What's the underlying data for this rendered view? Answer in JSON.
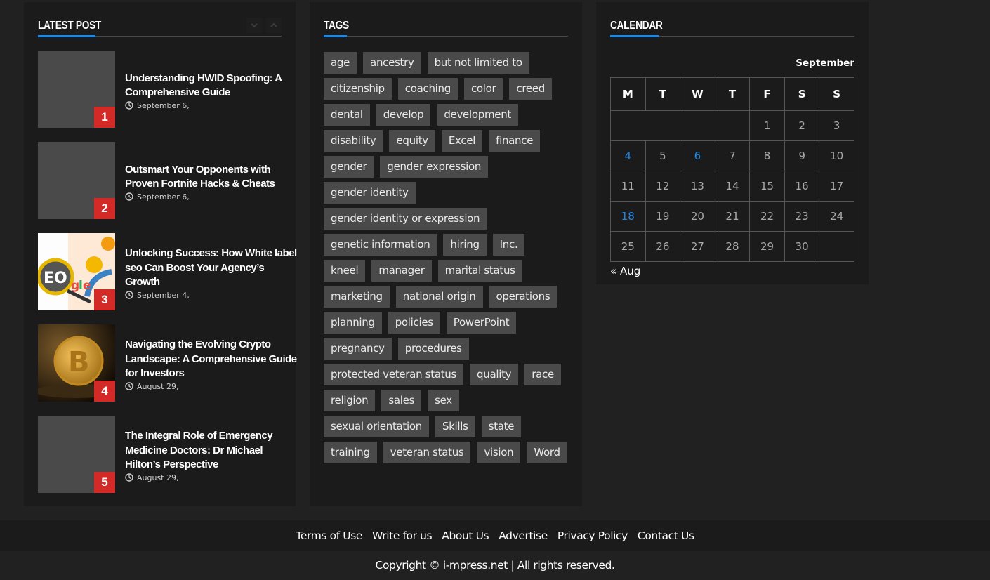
{
  "latest_post": {
    "title": "Latest Post",
    "nav": {
      "down_icon": "chevron-down-icon",
      "up_icon": "chevron-up-icon"
    },
    "posts": [
      {
        "rank": "1",
        "title": "Understanding HWID Spoofing: A Comprehensive Guide",
        "date": "September 6,",
        "thumbnail": "placeholder"
      },
      {
        "rank": "2",
        "title": "Outsmart Your Opponents with Proven Fortnite Hacks & Cheats",
        "date": "September 6,",
        "thumbnail": "placeholder"
      },
      {
        "rank": "3",
        "title": "Unlocking Success: How White label seo Can Boost Your Agency’s Growth",
        "date": "September 4,",
        "thumbnail": "seo-illustration"
      },
      {
        "rank": "4",
        "title": "Navigating the Evolving Crypto Landscape: A Comprehensive Guide for Investors",
        "date": "August 29,",
        "thumbnail": "bitcoin-photo"
      },
      {
        "rank": "5",
        "title": "The Integral Role of Emergency Medicine Doctors: Dr Michael Hilton’s Perspective",
        "date": "August 29,",
        "thumbnail": "placeholder"
      }
    ]
  },
  "tags": {
    "title": "Tags",
    "items": [
      "age",
      "ancestry",
      "but not limited to",
      "citizenship",
      "coaching",
      "color",
      "creed",
      "dental",
      "develop",
      "development",
      "disability",
      "equity",
      "Excel",
      "finance",
      "gender",
      "gender expression",
      "gender identity",
      "gender identity or expression",
      "genetic information",
      "hiring",
      "Inc.",
      "kneel",
      "manager",
      "marital status",
      "marketing",
      "national origin",
      "operations",
      "planning",
      "policies",
      "PowerPoint",
      "pregnancy",
      "procedures",
      "protected veteran status",
      "quality",
      "race",
      "religion",
      "sales",
      "sex",
      "sexual orientation",
      "Skills",
      "state",
      "training",
      "veteran status",
      "vision",
      "Word"
    ]
  },
  "calendar": {
    "title": "Calendar",
    "month": "September",
    "weekdays": [
      "M",
      "T",
      "W",
      "T",
      "F",
      "S",
      "S"
    ],
    "weeks": [
      [
        "",
        "",
        "",
        "",
        "1",
        "2",
        "3"
      ],
      [
        "4",
        "5",
        "6",
        "7",
        "8",
        "9",
        "10"
      ],
      [
        "11",
        "12",
        "13",
        "14",
        "15",
        "16",
        "17"
      ],
      [
        "18",
        "19",
        "20",
        "21",
        "22",
        "23",
        "24"
      ],
      [
        "25",
        "26",
        "27",
        "28",
        "29",
        "30",
        ""
      ]
    ],
    "linked_days": [
      "4",
      "6",
      "18"
    ],
    "prev_link": "« Aug"
  },
  "footer": {
    "links": [
      "Terms of Use",
      "Write for us",
      "About Us",
      "Advertise",
      "Privacy Policy",
      "Contact Us"
    ],
    "copyright": "Copyright © i-mpress.net | All rights reserved."
  },
  "colors": {
    "accent": "#1e88e5",
    "rank_badge": "#d32a27",
    "tag_bg": "#4a4a4a",
    "widget_bg": "#1b1b1b",
    "page_bg": "#212121"
  }
}
